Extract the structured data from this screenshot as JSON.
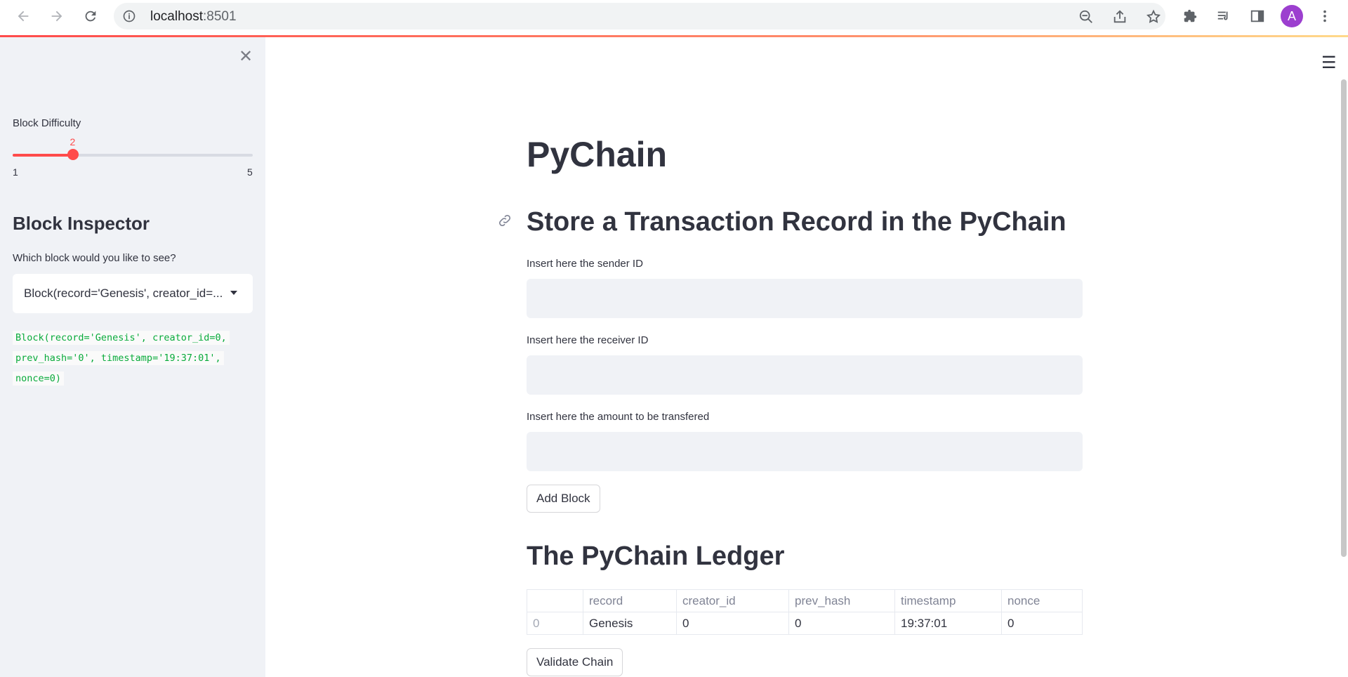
{
  "browser": {
    "url_host": "localhost",
    "url_port": ":8501",
    "avatar_letter": "A"
  },
  "sidebar": {
    "slider": {
      "label": "Block Difficulty",
      "value": "2",
      "min": "1",
      "max": "5",
      "fraction": 0.25
    },
    "inspector_heading": "Block Inspector",
    "select_label": "Which block would you like to see?",
    "select_value": "Block(record='Genesis', creator_id=0, prev_hash='0', timestamp='19:37:01', nonce=0)",
    "select_display": "Block(record='Genesis', creator_id=...",
    "code_lines": [
      "Block(record='Genesis', creator_id=0,",
      "prev_hash='0', timestamp='19:37:01',",
      "nonce=0)"
    ]
  },
  "main": {
    "title": "PyChain",
    "store_heading": "Store a Transaction Record in the PyChain",
    "sender_label": "Insert here the sender ID",
    "receiver_label": "Insert here the receiver ID",
    "amount_label": "Insert here the amount to be transfered",
    "add_block_label": "Add Block",
    "ledger_heading": "The PyChain Ledger",
    "ledger": {
      "columns": [
        "",
        "record",
        "creator_id",
        "prev_hash",
        "timestamp",
        "nonce"
      ],
      "rows": [
        [
          "0",
          "Genesis",
          "0",
          "0",
          "19:37:01",
          "0"
        ]
      ]
    },
    "validate_label": "Validate Chain"
  },
  "colors": {
    "accent": "#ff4b4b",
    "sidebar_bg": "#f0f2f6",
    "code_green": "#09ab3b",
    "text": "#31333f"
  }
}
